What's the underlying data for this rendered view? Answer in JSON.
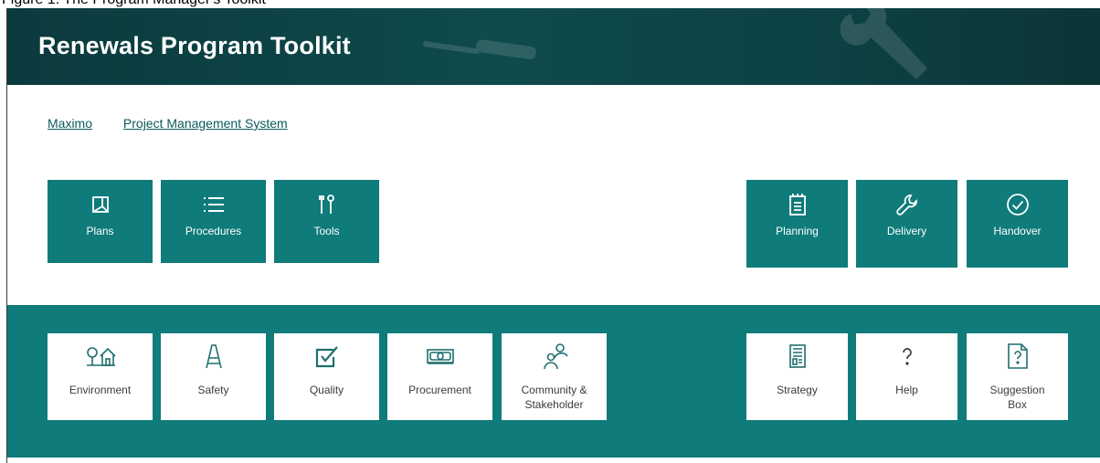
{
  "caption": "Figure 1: The Program Manager's Toolkit",
  "banner": {
    "title": "Renewals Program Toolkit"
  },
  "links": [
    {
      "label": "Maximo"
    },
    {
      "label": "Project Management System"
    }
  ],
  "top_tiles_left": [
    {
      "label": "Plans",
      "icon": "document-corner-icon"
    },
    {
      "label": "Procedures",
      "icon": "list-icon"
    },
    {
      "label": "Tools",
      "icon": "tools-icon"
    }
  ],
  "top_tiles_right": [
    {
      "label": "Planning",
      "icon": "notepad-icon"
    },
    {
      "label": "Delivery",
      "icon": "wrench-icon"
    },
    {
      "label": "Handover",
      "icon": "checkmark-circle-icon"
    }
  ],
  "bottom_tiles_left": [
    {
      "label": "Environment",
      "icon": "tree-house-icon"
    },
    {
      "label": "Safety",
      "icon": "ladder-icon"
    },
    {
      "label": "Quality",
      "icon": "checkbox-icon"
    },
    {
      "label": "Procurement",
      "icon": "money-icon"
    },
    {
      "label": "Community &\nStakeholder",
      "icon": "people-icon"
    }
  ],
  "bottom_tiles_right": [
    {
      "label": "Strategy",
      "icon": "document-report-icon"
    },
    {
      "label": "Help",
      "icon": "question-icon"
    },
    {
      "label": "Suggestion\nBox",
      "icon": "question-document-icon"
    }
  ],
  "colors": {
    "banner": "#0f4a4c",
    "tile": "#0f7b7a",
    "link": "#0b5a5e",
    "white_tile_text": "#3c3c3c"
  }
}
